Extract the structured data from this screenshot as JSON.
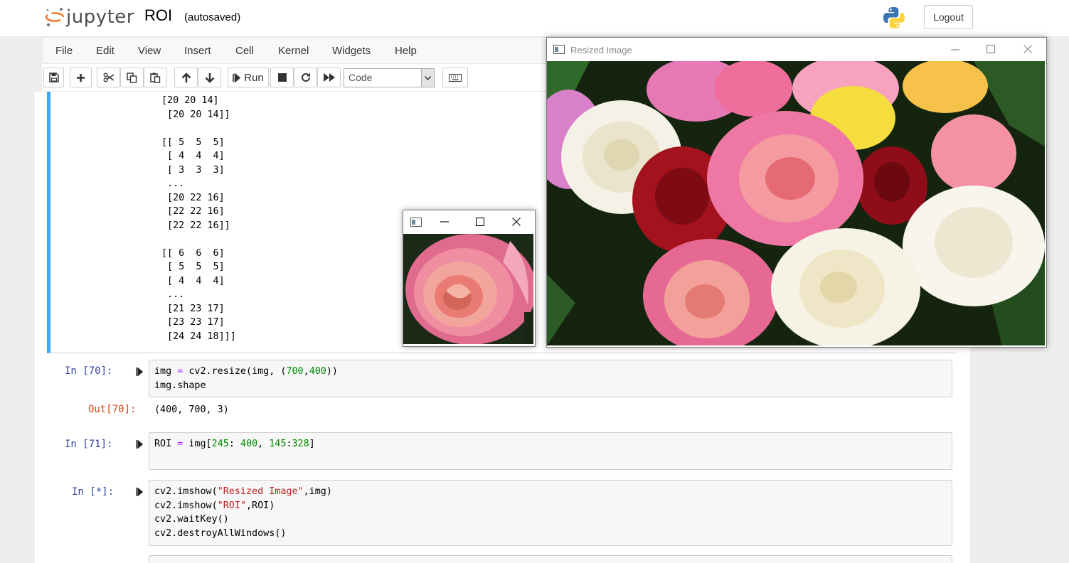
{
  "header": {
    "logo_text": "jupyter",
    "notebook_name": "ROI",
    "autosave_status": "(autosaved)",
    "logout_label": "Logout"
  },
  "menu": [
    "File",
    "Edit",
    "View",
    "Insert",
    "Cell",
    "Kernel",
    "Widgets",
    "Help"
  ],
  "toolbar": {
    "run_label": "Run",
    "cell_type": "Code"
  },
  "output_array": "[20 20 14]\n [20 20 14]]\n\n[[ 5  5  5]\n [ 4  4  4]\n [ 3  3  3]\n ...\n [20 22 16]\n [22 22 16]\n [22 22 16]]\n\n[[ 6  6  6]\n [ 5  5  5]\n [ 4  4  4]\n ...\n [21 23 17]\n [23 23 17]\n [24 24 18]]]",
  "cells": [
    {
      "prompt": "In [70]:",
      "out_prompt": "Out[70]:",
      "output": "(400, 700, 3)",
      "line1": {
        "a": "img ",
        "b": "=",
        "c": " cv2.resize(img, (",
        "d": "700",
        "e": ",",
        "f": "400",
        "g": "))"
      },
      "line2": "img.shape"
    },
    {
      "prompt": "In [71]:",
      "line1": {
        "a": "ROI ",
        "b": "=",
        "c": " img[",
        "d": "245",
        "e": ": ",
        "f": "400",
        "g": ", ",
        "h": "145",
        "i": ":",
        "j": "328",
        "k": "]"
      }
    },
    {
      "prompt": "In [*]:",
      "line1": {
        "a": "cv2.imshow(",
        "b": "\"Resized Image\"",
        "c": ",img)"
      },
      "line2": {
        "a": "cv2.imshow(",
        "b": "\"ROI\"",
        "c": ",ROI)"
      },
      "line3": "cv2.waitKey()",
      "line4": "cv2.destroyAllWindows()"
    }
  ],
  "windows": {
    "resized_title": "Resized Image",
    "roi_title": ""
  },
  "colors": {
    "selected_cell_border": "#42a5f5",
    "in_prompt": "#303f9f",
    "out_prompt": "#d84315"
  }
}
